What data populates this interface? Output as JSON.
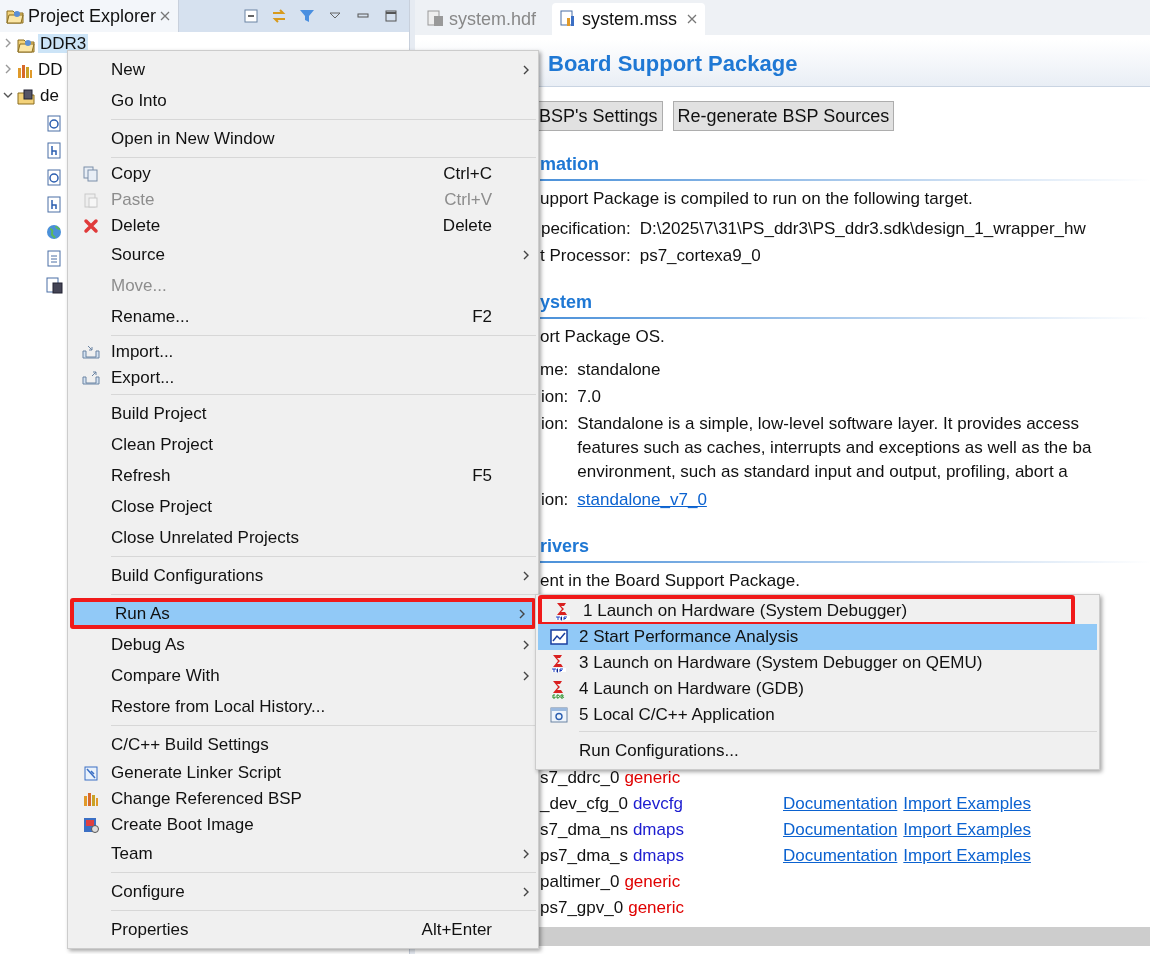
{
  "explorer": {
    "title": "Project Explorer",
    "tree": [
      {
        "label": "DDR3",
        "selected": true,
        "expanded": false,
        "kind": "app"
      },
      {
        "label": "DD",
        "selected": false,
        "expanded": false,
        "kind": "bsp"
      },
      {
        "label": "de",
        "selected": false,
        "expanded": true,
        "kind": "hw",
        "children": [
          {
            "kind": "c"
          },
          {
            "kind": "h"
          },
          {
            "kind": "c"
          },
          {
            "kind": "h"
          },
          {
            "kind": "web"
          },
          {
            "kind": "doc"
          },
          {
            "kind": "chip"
          }
        ]
      }
    ]
  },
  "editor_tabs": [
    {
      "label": "system.hdf",
      "selected": false,
      "kind": "hdf"
    },
    {
      "label": "system.mss",
      "selected": true,
      "kind": "mss"
    }
  ],
  "editor": {
    "title": "Board Support Package",
    "buttons": [
      "BSP's Settings",
      "Re-generate BSP Sources"
    ],
    "target": {
      "heading": "mation",
      "intro": "upport Package is compiled to run on the following target.",
      "rows": [
        {
          "label": "pecification:",
          "value": "D:\\2025\\7\\31\\PS_ddr3\\PS_ddr3.sdk\\design_1_wrapper_hw"
        },
        {
          "label": "t Processor:",
          "value": "ps7_cortexa9_0"
        }
      ]
    },
    "os": {
      "heading": "ystem",
      "intro": "ort Package OS.",
      "rows": [
        {
          "label": "me:",
          "lines": [
            "standalone"
          ]
        },
        {
          "label": "ion:",
          "lines": [
            "7.0"
          ]
        },
        {
          "label": "ion:",
          "lines": [
            "Standalone is a simple, low-level software layer. It provides access",
            "features such as caches, interrupts and exceptions as well as the ba",
            "environment, such as standard input and output, profiling, abort a"
          ]
        },
        {
          "label": "ion:",
          "link": "standalone_v7_0"
        }
      ]
    },
    "drivers": {
      "heading": "rivers",
      "intro": "ent in the Board Support Package.",
      "rows": [
        {
          "name": "s7_ddrc_0",
          "type": "generic",
          "color": "#e00000"
        },
        {
          "name": "_dev_cfg_0",
          "type": "devcfg",
          "color": "#1c1cd0",
          "links": [
            "Documentation",
            "Import Examples"
          ]
        },
        {
          "name": "s7_dma_ns",
          "type": "dmaps",
          "color": "#1c1cd0",
          "links": [
            "Documentation",
            "Import Examples"
          ]
        },
        {
          "name": "ps7_dma_s",
          "type": "dmaps",
          "color": "#1c1cd0",
          "links": [
            "Documentation",
            "Import Examples"
          ]
        },
        {
          "name": "paltimer_0",
          "type": "generic",
          "color": "#e00000"
        },
        {
          "name": "ps7_gpv_0",
          "type": "generic",
          "color": "#e00000"
        }
      ]
    }
  },
  "context_menu": {
    "groups": [
      [
        {
          "label": "New",
          "kind": "plain",
          "submenu": true,
          "disabled": false,
          "selected": false,
          "annotated": false
        },
        {
          "label": "Go Into",
          "kind": "plain",
          "submenu": false,
          "disabled": false,
          "selected": false,
          "annotated": false
        }
      ],
      [
        {
          "label": "Open in New Window",
          "kind": "plain",
          "submenu": false,
          "disabled": false,
          "selected": false,
          "annotated": false
        }
      ],
      [
        {
          "label": "Copy",
          "kind": "copy",
          "shortcut": "Ctrl+C",
          "submenu": false,
          "disabled": false,
          "selected": false,
          "annotated": false
        },
        {
          "label": "Paste",
          "kind": "paste",
          "shortcut": "Ctrl+V",
          "submenu": false,
          "disabled": true,
          "selected": false,
          "annotated": false
        },
        {
          "label": "Delete",
          "kind": "delete",
          "shortcut": "Delete",
          "submenu": false,
          "disabled": false,
          "selected": false,
          "annotated": false
        },
        {
          "label": "Source",
          "kind": "plain",
          "submenu": true,
          "disabled": false,
          "selected": false,
          "annotated": false
        },
        {
          "label": "Move...",
          "kind": "plain",
          "submenu": false,
          "disabled": true,
          "selected": false,
          "annotated": false
        },
        {
          "label": "Rename...",
          "kind": "plain",
          "shortcut": "F2",
          "submenu": false,
          "disabled": false,
          "selected": false,
          "annotated": false
        }
      ],
      [
        {
          "label": "Import...",
          "kind": "import",
          "submenu": false,
          "disabled": false,
          "selected": false,
          "annotated": false
        },
        {
          "label": "Export...",
          "kind": "export",
          "submenu": false,
          "disabled": false,
          "selected": false,
          "annotated": false
        }
      ],
      [
        {
          "label": "Build Project",
          "kind": "plain",
          "submenu": false,
          "disabled": false,
          "selected": false,
          "annotated": false
        },
        {
          "label": "Clean Project",
          "kind": "plain",
          "submenu": false,
          "disabled": false,
          "selected": false,
          "annotated": false
        },
        {
          "label": "Refresh",
          "kind": "plain",
          "shortcut": "F5",
          "submenu": false,
          "disabled": false,
          "selected": false,
          "annotated": false
        },
        {
          "label": "Close Project",
          "kind": "plain",
          "submenu": false,
          "disabled": false,
          "selected": false,
          "annotated": false
        },
        {
          "label": "Close Unrelated Projects",
          "kind": "plain",
          "submenu": false,
          "disabled": false,
          "selected": false,
          "annotated": false
        }
      ],
      [
        {
          "label": "Build Configurations",
          "kind": "plain",
          "submenu": true,
          "disabled": false,
          "selected": false,
          "annotated": false
        }
      ],
      [
        {
          "label": "Run As",
          "kind": "plain",
          "submenu": true,
          "disabled": false,
          "selected": true,
          "annotated": true
        },
        {
          "label": "Debug As",
          "kind": "plain",
          "submenu": true,
          "disabled": false,
          "selected": false,
          "annotated": false
        },
        {
          "label": "Compare With",
          "kind": "plain",
          "submenu": true,
          "disabled": false,
          "selected": false,
          "annotated": false
        },
        {
          "label": "Restore from Local History...",
          "kind": "plain",
          "submenu": false,
          "disabled": false,
          "selected": false,
          "annotated": false
        }
      ],
      [
        {
          "label": "C/C++ Build Settings",
          "kind": "plain",
          "submenu": false,
          "disabled": false,
          "selected": false,
          "annotated": false
        },
        {
          "label": "Generate Linker Script",
          "kind": "linker",
          "submenu": false,
          "disabled": false,
          "selected": false,
          "annotated": false
        },
        {
          "label": "Change Referenced BSP",
          "kind": "bsp",
          "submenu": false,
          "disabled": false,
          "selected": false,
          "annotated": false
        },
        {
          "label": "Create Boot Image",
          "kind": "boot",
          "submenu": false,
          "disabled": false,
          "selected": false,
          "annotated": false
        },
        {
          "label": "Team",
          "kind": "plain",
          "submenu": true,
          "disabled": false,
          "selected": false,
          "annotated": false
        }
      ],
      [
        {
          "label": "Configure",
          "kind": "plain",
          "submenu": true,
          "disabled": false,
          "selected": false,
          "annotated": false
        }
      ],
      [
        {
          "label": "Properties",
          "kind": "plain",
          "shortcut": "Alt+Enter",
          "submenu": false,
          "disabled": false,
          "selected": false,
          "annotated": false
        }
      ]
    ]
  },
  "run_as_menu": {
    "groups": [
      [
        {
          "label": "1 Launch on Hardware (System Debugger)",
          "kind": "tcf",
          "selected": false,
          "annotated": true
        },
        {
          "label": "2 Start Performance Analysis",
          "kind": "chart",
          "selected": true,
          "annotated": false
        },
        {
          "label": "3 Launch on Hardware (System Debugger on QEMU)",
          "kind": "tcf",
          "selected": false,
          "annotated": false
        },
        {
          "label": "4 Launch on Hardware (GDB)",
          "kind": "gdb",
          "selected": false,
          "annotated": false
        },
        {
          "label": "5 Local C/C++ Application",
          "kind": "capp",
          "selected": false,
          "annotated": false
        }
      ],
      [
        {
          "label": "Run Configurations...",
          "kind": "plain",
          "selected": false,
          "annotated": false
        }
      ]
    ]
  }
}
